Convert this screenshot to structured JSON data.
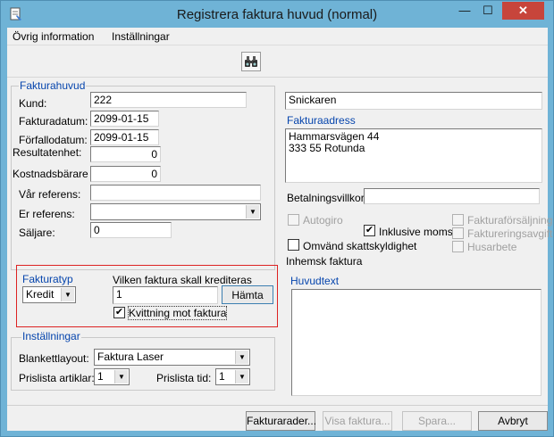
{
  "window": {
    "title": "Registrera faktura huvud (normal)",
    "minimize": "—",
    "maximize": "☐",
    "close": "✕"
  },
  "menu": [
    "Övrig information",
    "Inställningar"
  ],
  "toolbar": {
    "find_icon": "binoculars-icon",
    "find_glyph": "🔍"
  },
  "fakturahuvud": {
    "legend": "Fakturahuvud",
    "kund_label": "Kund:",
    "kund_value": "222",
    "fakturadatum_label": "Fakturadatum:",
    "fakturadatum_value": "2099-01-15",
    "forfallodatum_label": "Förfallodatum:",
    "forfallodatum_value": "2099-01-15",
    "resultatenhet_label": "Resultatenhet:",
    "resultatenhet_value": "0",
    "kostnadsbarare_label": "Kostnadsbärare",
    "kostnadsbarare_value": "0",
    "var_referens_label": "Vår referens:",
    "var_referens_value": "",
    "er_referens_label": "Er referens:",
    "er_referens_value": "",
    "saljare_label": "Säljare:",
    "saljare_value": "0"
  },
  "customer": {
    "name": "Snickaren",
    "address_label": "Fakturaadress",
    "address_line1": "Hammarsvägen 44",
    "address_line2": "333 55 Rotunda",
    "betalningsvillkor_label": "Betalningsvillkor:",
    "betalningsvillkor_value": ""
  },
  "options": {
    "autogiro": "Autogiro",
    "autogiro_checked": false,
    "inklusive_moms": "Inklusive moms",
    "inklusive_moms_checked": true,
    "omvand": "Omvänd skattskyldighet",
    "omvand_checked": false,
    "inhemsk": "Inhemsk faktura",
    "fakturaforsaljning": "Fakturaförsäljning",
    "faktureringsavgift": "Faktureringsavgift",
    "husarbete": "Husarbete"
  },
  "fakturatyp": {
    "legend": "Fakturatyp",
    "value": "Kredit",
    "kreditera_label": "Vilken faktura skall krediteras",
    "kreditera_value": "1",
    "hamta": "Hämta",
    "kvittning": "Kvittning mot faktura",
    "kvittning_checked": true
  },
  "installningar": {
    "legend": "Inställningar",
    "blankettlayout_label": "Blankettlayout:",
    "blankettlayout_value": "Faktura Laser",
    "prislista_artiklar_label": "Prislista artiklar:",
    "prislista_artiklar_value": "1",
    "prislista_tid_label": "Prislista tid:",
    "prislista_tid_value": "1"
  },
  "huvudtext": {
    "legend": "Huvudtext",
    "value": ""
  },
  "buttons": {
    "fakturarader": "Fakturarader...",
    "visa_faktura": "Visa faktura...",
    "spara": "Spara...",
    "avbryt": "Avbryt"
  }
}
